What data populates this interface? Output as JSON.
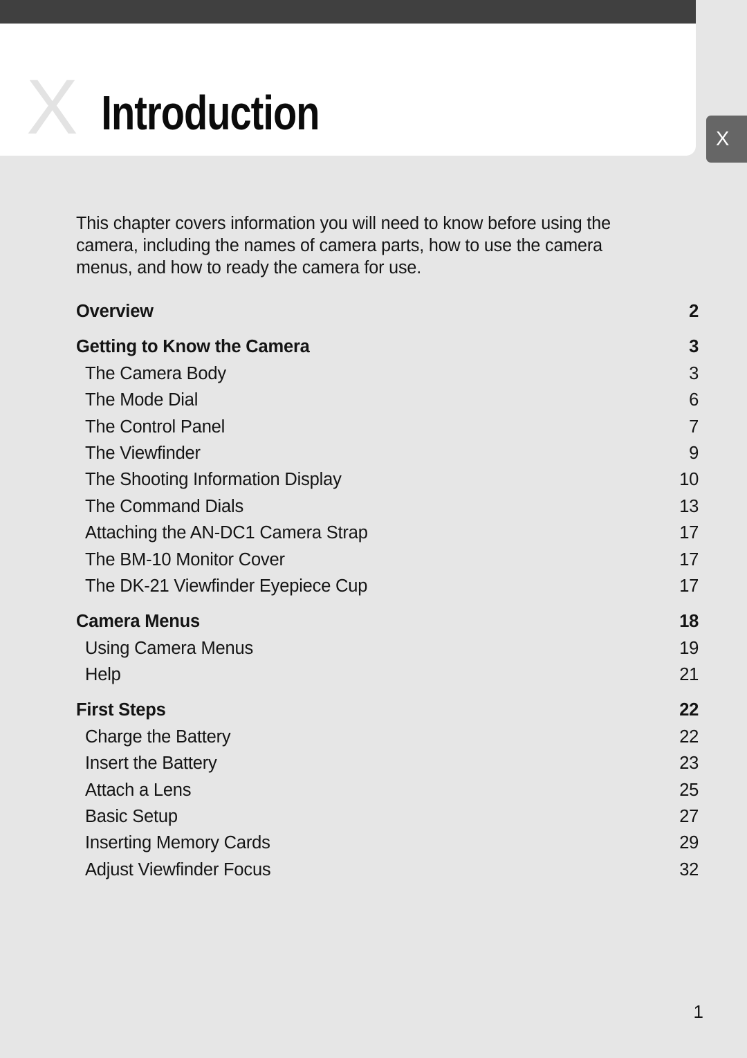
{
  "page": {
    "background_color": "#e6e6e6",
    "top_bar_color": "#404040",
    "title_block_color": "#ffffff",
    "folio": "1"
  },
  "header": {
    "chapter_mark": "X",
    "chapter_title": "Introduction",
    "tab_label": "X",
    "tab_color": "#666666",
    "mark_color": "#e3e3e3"
  },
  "intro": {
    "paragraph": "This chapter covers information you will need to know before using the camera, including the names of camera parts, how to use the camera menus, and how to ready the camera for use."
  },
  "toc": {
    "entries": [
      {
        "label": "Overview",
        "page": "2",
        "level": 1,
        "gap_before": false
      },
      {
        "label": "Getting to Know the Camera",
        "page": "3",
        "level": 1,
        "gap_before": true
      },
      {
        "label": "The Camera Body",
        "page": "3",
        "level": 2,
        "gap_before": false
      },
      {
        "label": "The Mode Dial",
        "page": "6",
        "level": 2,
        "gap_before": false
      },
      {
        "label": "The Control Panel",
        "page": "7",
        "level": 2,
        "gap_before": false
      },
      {
        "label": "The Viewfinder",
        "page": "9",
        "level": 2,
        "gap_before": false
      },
      {
        "label": "The Shooting Information Display",
        "page": "10",
        "level": 2,
        "gap_before": false
      },
      {
        "label": "The Command Dials",
        "page": "13",
        "level": 2,
        "gap_before": false
      },
      {
        "label": "Attaching the AN-DC1 Camera Strap",
        "page": "17",
        "level": 2,
        "gap_before": false
      },
      {
        "label": "The BM-10 Monitor Cover",
        "page": "17",
        "level": 2,
        "gap_before": false
      },
      {
        "label": "The DK-21 Viewfinder Eyepiece Cup",
        "page": "17",
        "level": 2,
        "gap_before": false
      },
      {
        "label": "Camera Menus",
        "page": "18",
        "level": 1,
        "gap_before": true
      },
      {
        "label": "Using Camera Menus",
        "page": "19",
        "level": 2,
        "gap_before": false
      },
      {
        "label": "Help",
        "page": "21",
        "level": 2,
        "gap_before": false
      },
      {
        "label": "First Steps",
        "page": "22",
        "level": 1,
        "gap_before": true
      },
      {
        "label": "Charge the Battery",
        "page": "22",
        "level": 2,
        "gap_before": false
      },
      {
        "label": "Insert the Battery",
        "page": "23",
        "level": 2,
        "gap_before": false
      },
      {
        "label": "Attach a Lens",
        "page": "25",
        "level": 2,
        "gap_before": false
      },
      {
        "label": "Basic Setup",
        "page": "27",
        "level": 2,
        "gap_before": false
      },
      {
        "label": "Inserting Memory Cards",
        "page": "29",
        "level": 2,
        "gap_before": false
      },
      {
        "label": "Adjust Viewfinder Focus",
        "page": "32",
        "level": 2,
        "gap_before": false
      }
    ]
  }
}
